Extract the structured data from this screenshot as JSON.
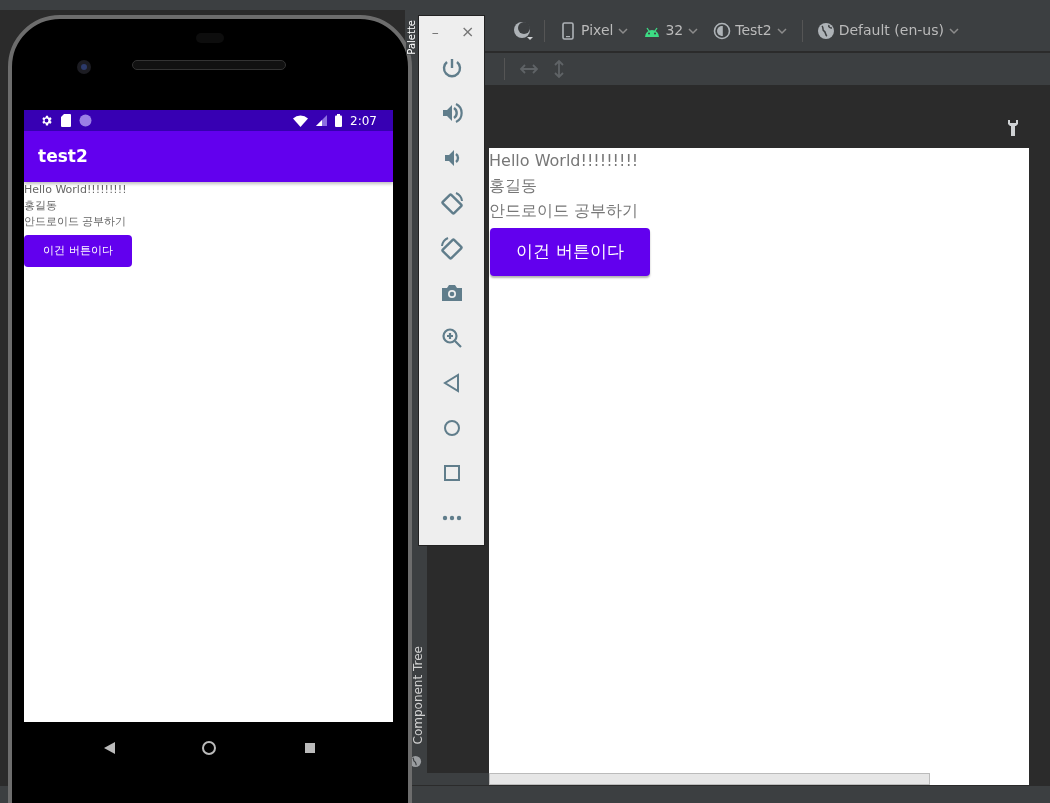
{
  "ide": {
    "toolbar": [
      {
        "kind": "device",
        "label": "Pixel"
      },
      {
        "kind": "api",
        "label": "32"
      },
      {
        "kind": "theme",
        "label": "Test2"
      },
      {
        "kind": "locale",
        "label": "Default (en-us)"
      }
    ],
    "side_tabs": [
      {
        "kind": "palette",
        "label": "Palette"
      },
      {
        "kind": "component_tree",
        "label": "Component Tree"
      }
    ],
    "preview": {
      "texts": [
        "Hello World!!!!!!!!!",
        "홍길동",
        "안드로이드 공부하기"
      ],
      "button": "이건 버튼이다"
    }
  },
  "phone": {
    "status_bar": {
      "time": "2:07"
    },
    "app_bar": {
      "title": "test2"
    },
    "texts": [
      "Hello World!!!!!!!!!",
      "홍길동",
      "안드로이드 공부하기"
    ],
    "button": "이건 버튼이다"
  },
  "emulator_controls": {
    "minimize": "–",
    "close": "×"
  }
}
